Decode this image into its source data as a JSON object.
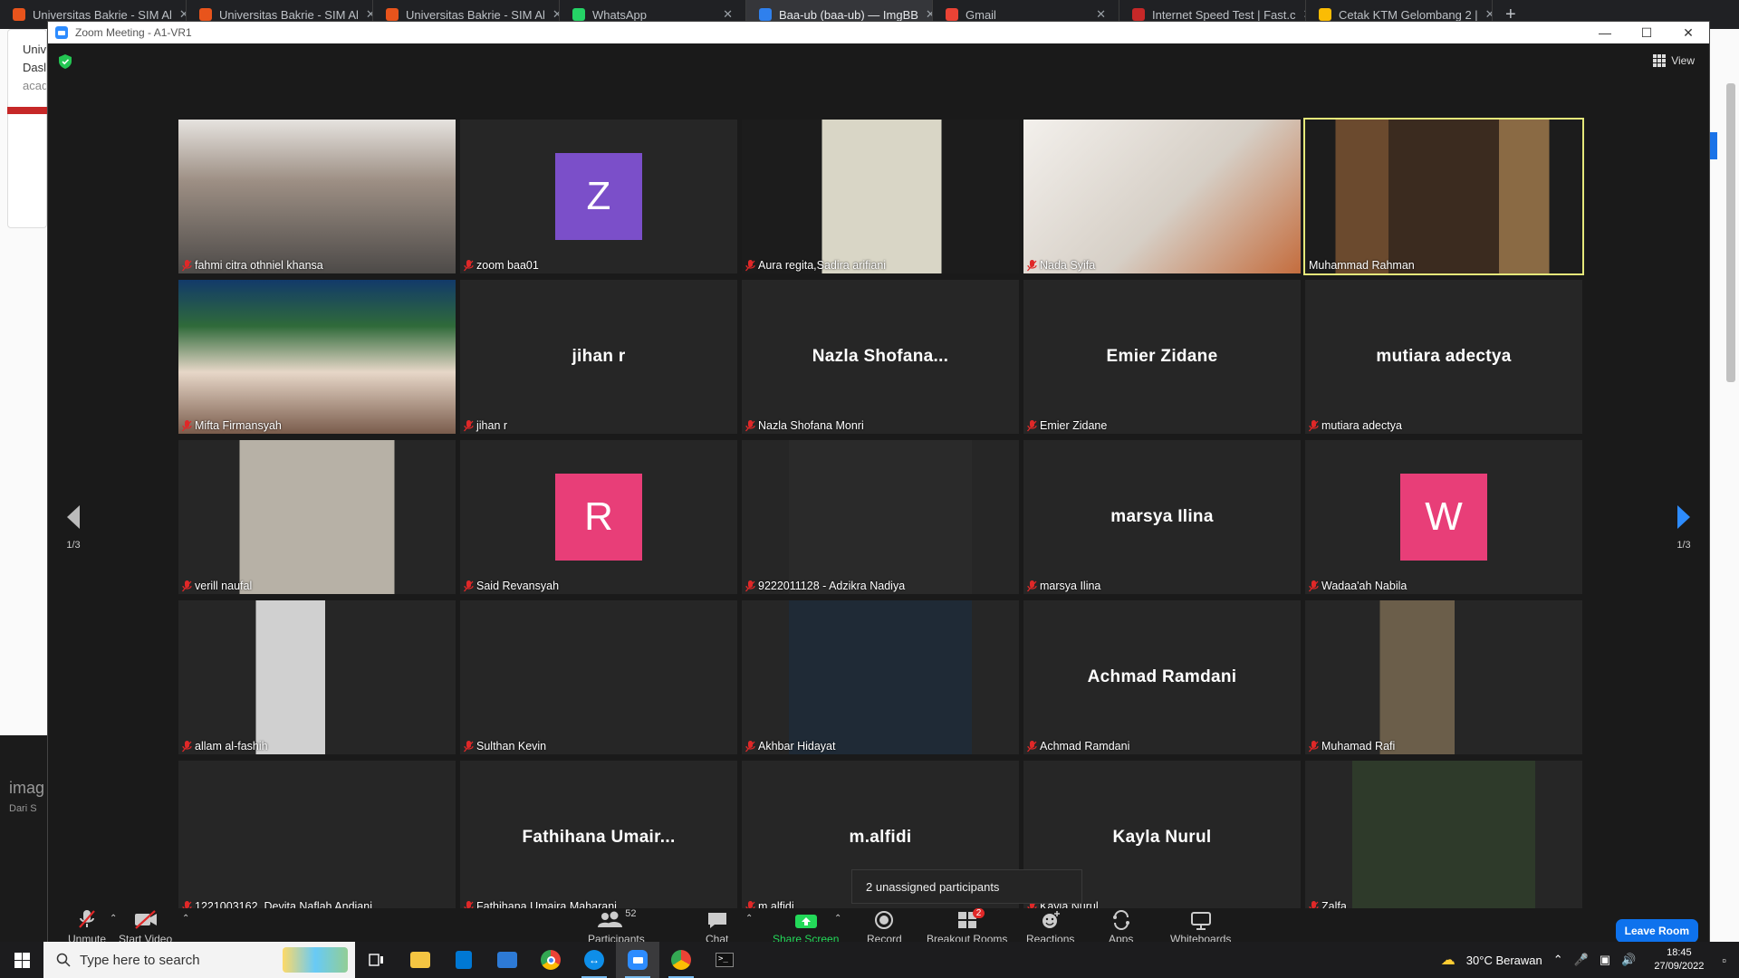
{
  "browser": {
    "tabs": [
      {
        "title": "Universitas Bakrie - SIM Al",
        "color": "#e8541c"
      },
      {
        "title": "Universitas Bakrie - SIM Al",
        "color": "#e8541c"
      },
      {
        "title": "Universitas Bakrie - SIM Al",
        "color": "#e8541c"
      },
      {
        "title": "WhatsApp",
        "color": "#25d366"
      },
      {
        "title": "Baa-ub (baa-ub) — ImgBB",
        "color": "#2f80ed"
      },
      {
        "title": "Gmail",
        "color": "#ea4335"
      },
      {
        "title": "Internet Speed Test | Fast.c",
        "color": "#c62828"
      },
      {
        "title": "Cetak KTM Gelombang 2 |",
        "color": "#fbbc04"
      }
    ],
    "new_tab": "+",
    "left_fragment": [
      "Univ",
      "Dasl",
      "acad"
    ],
    "bottom_fragment": [
      "imag",
      "Dari S"
    ]
  },
  "zoom": {
    "title": "Zoom Meeting - A1-VR1",
    "view_label": "View",
    "page_left": "1/3",
    "page_right": "1/3",
    "popup_text": "2 unassigned participants",
    "participants": [
      {
        "name": "fahmi citra othniel khansa",
        "type": "video",
        "muted": true,
        "scene": "group"
      },
      {
        "name": "zoom baa01",
        "type": "avatar",
        "letter": "Z",
        "avatar_color": "#7b4fc9",
        "muted": true
      },
      {
        "name": "Aura regita,Sadira arifiani",
        "type": "video",
        "muted": true,
        "scene": "plants"
      },
      {
        "name": "Nada Syifa",
        "type": "video",
        "muted": true,
        "scene": "hijab-room"
      },
      {
        "name": "Muhammad Rahman",
        "type": "video",
        "muted": false,
        "speaking": true,
        "scene": "bookshelf"
      },
      {
        "name": "Mifta Firmansyah",
        "type": "video",
        "muted": true,
        "scene": "couple"
      },
      {
        "name": "jihan r",
        "type": "name",
        "display": "jihan r",
        "muted": true
      },
      {
        "name": "Nazla Shofana Monri",
        "type": "name",
        "display": "Nazla  Shofana...",
        "muted": true
      },
      {
        "name": "Emier Zidane",
        "type": "name",
        "display": "Emier Zidane",
        "muted": true
      },
      {
        "name": "mutiara adectya",
        "type": "name",
        "display": "mutiara adectya",
        "muted": true
      },
      {
        "name": "verill naufal",
        "type": "video",
        "muted": true,
        "scene": "plant-floor"
      },
      {
        "name": "Said Revansyah",
        "type": "avatar",
        "letter": "R",
        "avatar_color": "#e83e78",
        "muted": true
      },
      {
        "name": "9222011128 - Adzikra Nadiya",
        "type": "video",
        "muted": true,
        "scene": "cat-black"
      },
      {
        "name": "marsya Ilina",
        "type": "name",
        "display": "marsya Ilina",
        "muted": true
      },
      {
        "name": "Wadaa'ah Nabila",
        "type": "avatar",
        "letter": "W",
        "avatar_color": "#e83e78",
        "muted": true
      },
      {
        "name": "allam al-fashih",
        "type": "video",
        "muted": true,
        "scene": "bw-photo"
      },
      {
        "name": "Sulthan Kevin",
        "type": "blank",
        "muted": true
      },
      {
        "name": "Akhbar Hidayat",
        "type": "video",
        "muted": true,
        "scene": "cat-blue"
      },
      {
        "name": "Achmad Ramdani",
        "type": "name",
        "display": "Achmad Ramdani",
        "muted": true
      },
      {
        "name": "Muhamad Rafi",
        "type": "video",
        "muted": true,
        "scene": "two-masks"
      },
      {
        "name": "1221003162_Devita Naflah Andjani",
        "type": "blank",
        "muted": true
      },
      {
        "name": "Fathihana Umaira Maharani",
        "type": "name",
        "display": "Fathihana  Umair...",
        "muted": true
      },
      {
        "name": "m.alfidi",
        "type": "name",
        "display": "m.alfidi",
        "muted": true
      },
      {
        "name": "Kayla Nurul",
        "type": "name",
        "display": "Kayla Nurul",
        "muted": true
      },
      {
        "name": "Zalfa",
        "type": "video",
        "muted": true,
        "scene": "hijab-white"
      }
    ],
    "toolbar": {
      "unmute": "Unmute",
      "start_video": "Start Video",
      "participants": "Participants",
      "participants_count": "52",
      "chat": "Chat",
      "share_screen": "Share Screen",
      "record": "Record",
      "breakout_rooms": "Breakout Rooms",
      "breakout_badge": "2",
      "reactions": "Reactions",
      "apps": "Apps",
      "whiteboards": "Whiteboards",
      "leave_room": "Leave Room"
    }
  },
  "taskbar": {
    "search_placeholder": "Type here to search",
    "weather": "30°C  Berawan",
    "time": "18:45",
    "date": "27/09/2022"
  },
  "colors": {
    "zoom_blue": "#2d8cff",
    "speaking_border": "#e5e87a",
    "mic_red": "#e02828",
    "share_green": "#23d959"
  }
}
